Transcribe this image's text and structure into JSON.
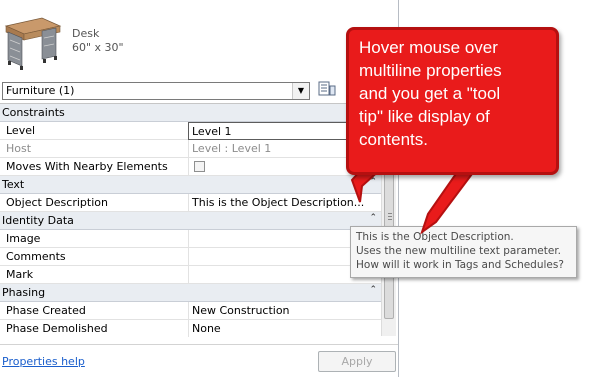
{
  "type_selector": {
    "family_name": "Desk",
    "type_name": "60\" x 30\""
  },
  "instance_filter": {
    "value": "Furniture (1)"
  },
  "groups": {
    "constraints": "Constraints",
    "text": "Text",
    "identity_data": "Identity Data",
    "phasing": "Phasing"
  },
  "properties": {
    "level": {
      "label": "Level",
      "value": "Level 1"
    },
    "host": {
      "label": "Host",
      "value": "Level : Level 1"
    },
    "moves_with": {
      "label": "Moves With Nearby Elements"
    },
    "object_description": {
      "label": "Object Description",
      "value": "This is the Object Description..."
    },
    "image": {
      "label": "Image",
      "value": ""
    },
    "comments": {
      "label": "Comments",
      "value": ""
    },
    "mark": {
      "label": "Mark",
      "value": ""
    },
    "phase_created": {
      "label": "Phase Created",
      "value": "New Construction"
    },
    "phase_demolished": {
      "label": "Phase Demolished",
      "value": "None"
    }
  },
  "footer": {
    "help_link": "Properties help",
    "apply_label": "Apply"
  },
  "tooltip": {
    "line1": "This is the Object Description.",
    "line2": "Uses the new multiline text parameter.",
    "line3": "How will it work in Tags and Schedules?"
  },
  "callout": {
    "line1": "Hover mouse over",
    "line2": "multiline properties",
    "line3": "and you get a \"tool",
    "line4": "tip\" like display of",
    "line5": "contents."
  },
  "colors": {
    "callout_fill": "#e91b1b",
    "link": "#1a5ecc",
    "group_band": "#e9edf2"
  }
}
